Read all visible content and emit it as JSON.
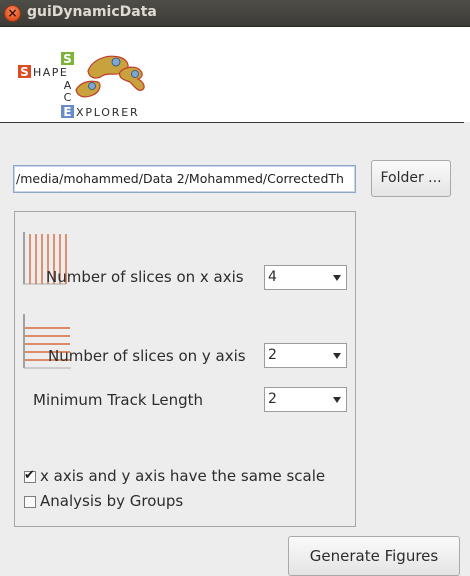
{
  "window": {
    "title": "guiDynamicData",
    "close_glyph": "×"
  },
  "logo": {
    "name": "SHAPE SPACE EXPLORER",
    "icon": "shapespace-explorer-logo"
  },
  "folder": {
    "path": "/media/mohammed/Data 2/Mohammed/CorrectedTh",
    "button_label": "Folder ..."
  },
  "options": {
    "x_slices": {
      "label": "Number of slices on x axis",
      "value": "4",
      "icon": "x-slices-icon"
    },
    "y_slices": {
      "label": "Number of slices on y axis",
      "value": "2",
      "icon": "y-slices-icon"
    },
    "min_track": {
      "label": "Minimum Track Length",
      "value": "2"
    },
    "same_scale": {
      "label": "x axis and y axis have the same scale",
      "checked": true
    },
    "by_groups": {
      "label": "Analysis by Groups",
      "checked": false
    }
  },
  "actions": {
    "generate_label": "Generate Figures"
  },
  "colors": {
    "accent": "#e2521d",
    "logo_red": "#e04a22",
    "logo_green": "#7cb43a",
    "logo_blue": "#6a8bc9",
    "cell_fill": "#c8a23c"
  }
}
